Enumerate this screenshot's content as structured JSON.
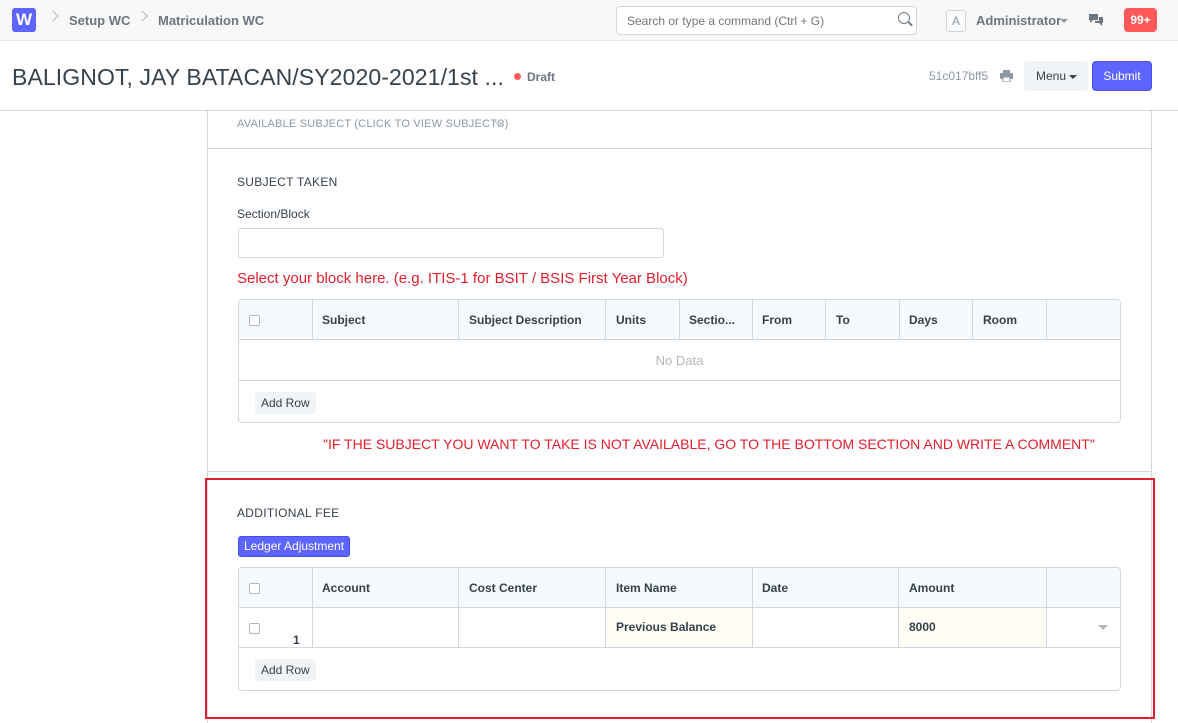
{
  "navbar": {
    "logo_letter": "W",
    "breadcrumbs": [
      "Setup WC",
      "Matriculation WC"
    ],
    "search_placeholder": "Search or type a command (Ctrl + G)",
    "avatar_letter": "A",
    "user_name": "Administrator",
    "notifications_count": "99+"
  },
  "page_head": {
    "title": "BALIGNOT, JAY BATACAN/SY2020-2021/1st ...",
    "status": "Draft",
    "doc_id": "51c017bff5",
    "menu_label": "Menu",
    "submit_label": "Submit"
  },
  "sections": {
    "available_subject": "AVAILABLE SUBJECT (CLICK TO VIEW SUBJECTS)",
    "subject_taken": {
      "title": "SUBJECT TAKEN",
      "section_block_label": "Section/Block",
      "section_block_value": "",
      "help_text": "Select your block here. (e.g. ITIS-1 for BSIT / BSIS First Year Block)",
      "columns": [
        "Subject",
        "Subject Description",
        "Units",
        "Sectio...",
        "From",
        "To",
        "Days",
        "Room"
      ],
      "no_data": "No Data",
      "add_row": "Add Row",
      "comment_note": "\"IF THE SUBJECT YOU WANT TO TAKE IS NOT AVAILABLE, GO TO THE BOTTOM SECTION AND WRITE A COMMENT\""
    },
    "additional_fee": {
      "title": "ADDITIONAL FEE",
      "ledger_button": "Ledger Adjustment",
      "columns": [
        "Account",
        "Cost Center",
        "Item Name",
        "Date",
        "Amount"
      ],
      "rows": [
        {
          "idx": "1",
          "account": "",
          "cost_center": "",
          "item_name": "Previous Balance",
          "date": "",
          "amount": "8000"
        }
      ],
      "add_row": "Add Row"
    }
  },
  "colors": {
    "primary": "#5e64ff",
    "danger": "#e1202e",
    "badge": "#ff5858"
  }
}
